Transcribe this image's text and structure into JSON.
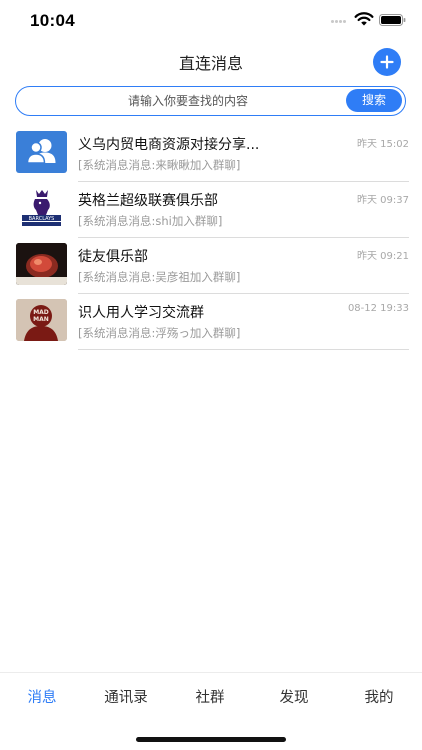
{
  "status_bar": {
    "time": "10:04"
  },
  "header": {
    "title": "直连消息",
    "add_icon": "plus-icon"
  },
  "search": {
    "placeholder": "请输入你要查找的内容",
    "button_label": "搜索"
  },
  "colors": {
    "accent": "#2f7df6",
    "divider": "#dcdcdc",
    "muted_text": "#9a9a9a"
  },
  "chats": [
    {
      "name": "义乌内贸电商资源对接分享...",
      "time": "昨天 15:02",
      "preview": "[系统消息消息:来瞅瞅加入群聊]",
      "avatar": "group-people-icon"
    },
    {
      "name": "英格兰超级联赛俱乐部",
      "time": "昨天 09:37",
      "preview": "[系统消息消息:shi加入群聊]",
      "avatar": "premier-league-logo"
    },
    {
      "name": "徒友俱乐部",
      "time": "昨天 09:21",
      "preview": "[系统消息消息:吴彦祖加入群聊]",
      "avatar": "food-photo"
    },
    {
      "name": "识人用人学习交流群",
      "time": "08-12 19:33",
      "preview": "[系统消息消息:浮殇っ加入群聊]",
      "avatar": "mad-man-poster",
      "avatar_text": "MAD MAN"
    }
  ],
  "tabs": [
    {
      "label": "消息",
      "active": true
    },
    {
      "label": "通讯录",
      "active": false
    },
    {
      "label": "社群",
      "active": false
    },
    {
      "label": "发现",
      "active": false
    },
    {
      "label": "我的",
      "active": false
    }
  ]
}
